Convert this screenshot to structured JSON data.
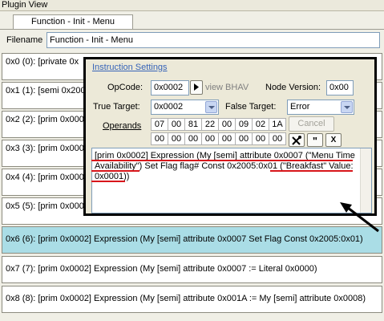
{
  "window": {
    "title": "Plugin View"
  },
  "tabs": [
    {
      "label": "Function - Init - Menu"
    }
  ],
  "filename": {
    "label": "Filename",
    "value": "Function - Init - Menu"
  },
  "rows": [
    {
      "text": "0x0 (0): [private 0x"
    },
    {
      "text": "0x1 (1): [semi 0x200"
    },
    {
      "text": "0x2 (2): [prim 0x000"
    },
    {
      "text": "0x3 (3): [prim 0x000"
    },
    {
      "text": "0x4 (4): [prim 0x000"
    },
    {
      "text": "0x5 (5): [prim 0x000"
    },
    {
      "text": "0x6 (6): [prim 0x0002] Expression (My [semi] attribute 0x0007 Set Flag Const 0x2005:0x01)"
    },
    {
      "text": "0x7 (7): [prim 0x0002] Expression (My [semi] attribute 0x0007 := Literal 0x0000)"
    },
    {
      "text": "0x8 (8): [prim 0x0002] Expression (My [semi] attribute 0x001A := My [semi] attribute 0x0008)"
    }
  ],
  "dialog": {
    "title": "Instruction Settings",
    "opcode": {
      "label": "OpCode:",
      "value": "0x0002",
      "view_link": "view BHAV"
    },
    "node_version": {
      "label": "Node Version:",
      "value": "0x00"
    },
    "true_target": {
      "label": "True Target:",
      "value": "0x0002"
    },
    "false_target": {
      "label": "False Target:",
      "value": "Error"
    },
    "operands": {
      "label": "Operands",
      "row1": [
        "07",
        "00",
        "81",
        "22",
        "00",
        "09",
        "02",
        "1A"
      ],
      "row2": [
        "00",
        "00",
        "00",
        "00",
        "00",
        "00",
        "00",
        "00"
      ]
    },
    "cancel_label": "Cancel",
    "buttons": {
      "quote": "\"",
      "close": "X"
    },
    "description": "[prim 0x0002] Expression (My [semi] attribute 0x0007 (\"Menu Time Availability\") Set Flag flag# Const 0x2005:0x01 (\"Breakfast\" Value: 0x0001))"
  },
  "colors": {
    "selected_row": "#aadde6",
    "annotation_underline": "#d8161b",
    "dialog_title": "#3764b8"
  }
}
